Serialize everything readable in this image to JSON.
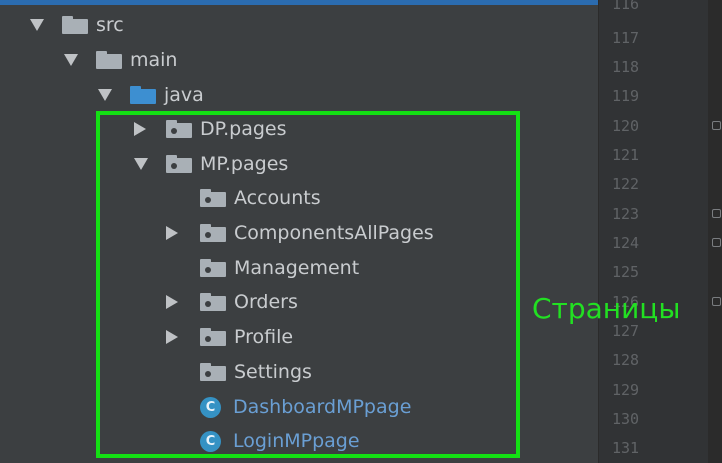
{
  "tree": {
    "src": "src",
    "main": "main",
    "java": "java",
    "dp_pages": "DP.pages",
    "mp_pages": "MP.pages",
    "accounts": "Accounts",
    "components_all_pages": "ComponentsAllPages",
    "management": "Management",
    "orders": "Orders",
    "profile": "Profile",
    "settings": "Settings",
    "dashboard_mp_page": "DashboardMPpage",
    "login_mp_page": "LoginMPpage",
    "class_icon_glyph": "C"
  },
  "gutter": {
    "line_numbers": [
      "116",
      "117",
      "118",
      "119",
      "120",
      "121",
      "122",
      "123",
      "124",
      "125",
      "126",
      "127",
      "128",
      "129",
      "130",
      "131"
    ]
  },
  "annotation": {
    "text": "Страницы",
    "color": "#22e022"
  },
  "colors": {
    "highlight_border": "#14e014",
    "folder_blue": "#3d8fd1",
    "class_icon": "#3592c4"
  }
}
